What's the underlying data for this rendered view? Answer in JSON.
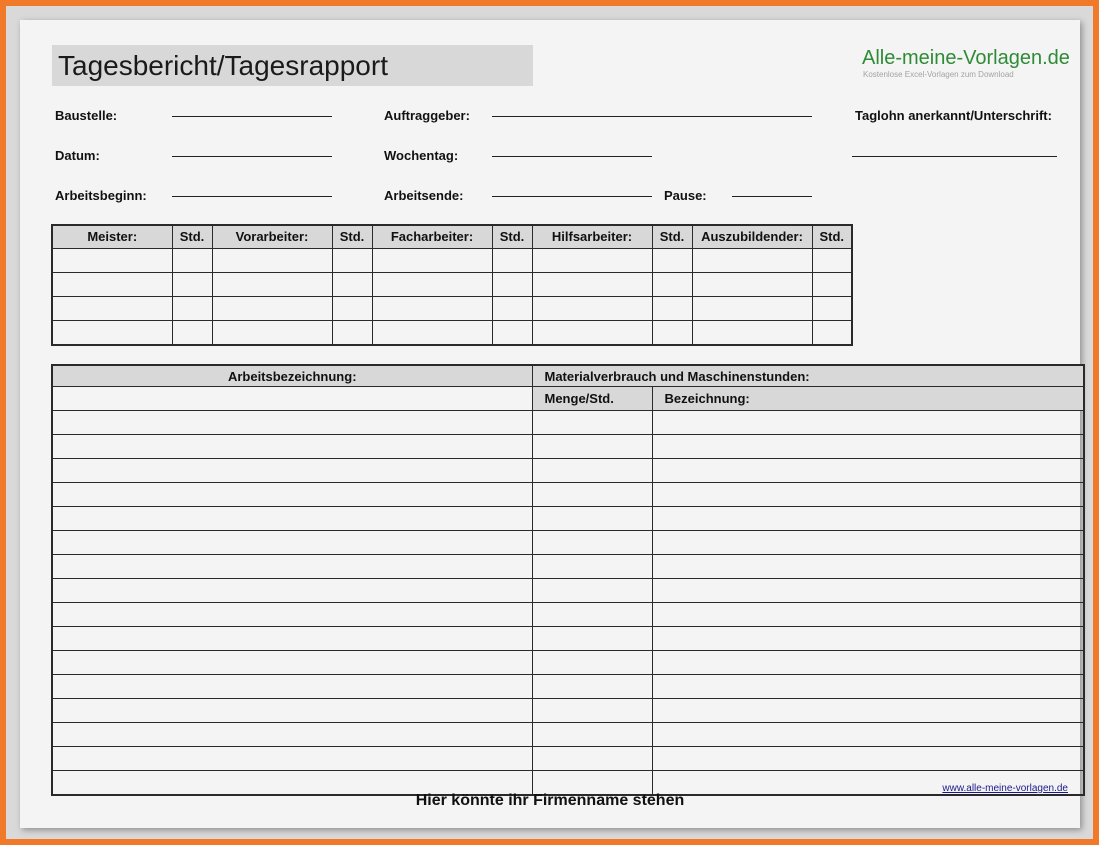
{
  "title": "Tagesbericht/Tagesrapport",
  "logo": {
    "name": "Alle-meine-Vorlagen.de",
    "tagline": "Kostenlose Excel-Vorlagen zum Download"
  },
  "fields": {
    "baustelle": "Baustelle:",
    "auftraggeber": "Auftraggeber:",
    "taglohn": "Taglohn anerkannt/Unterschrift:",
    "datum": "Datum:",
    "wochentag": "Wochentag:",
    "arbeitsbeginn": "Arbeitsbeginn:",
    "arbeitsende": "Arbeitsende:",
    "pause": "Pause:"
  },
  "staff_table": {
    "headers": [
      "Meister:",
      "Std.",
      "Vorarbeiter:",
      "Std.",
      "Facharbeiter:",
      "Std.",
      "Hilfsarbeiter:",
      "Std.",
      "Auszubildender:",
      "Std."
    ]
  },
  "work_table": {
    "arbeitsbezeichnung": "Arbeitsbezeichnung:",
    "material": "Materialverbrauch und Maschinenstunden:",
    "menge": "Menge/Std.",
    "bezeichnung": "Bezeichnung:"
  },
  "footer": {
    "firm": "Hier könnte ihr Firmenname stehen",
    "url": "www.alle-meine-vorlagen.de"
  }
}
